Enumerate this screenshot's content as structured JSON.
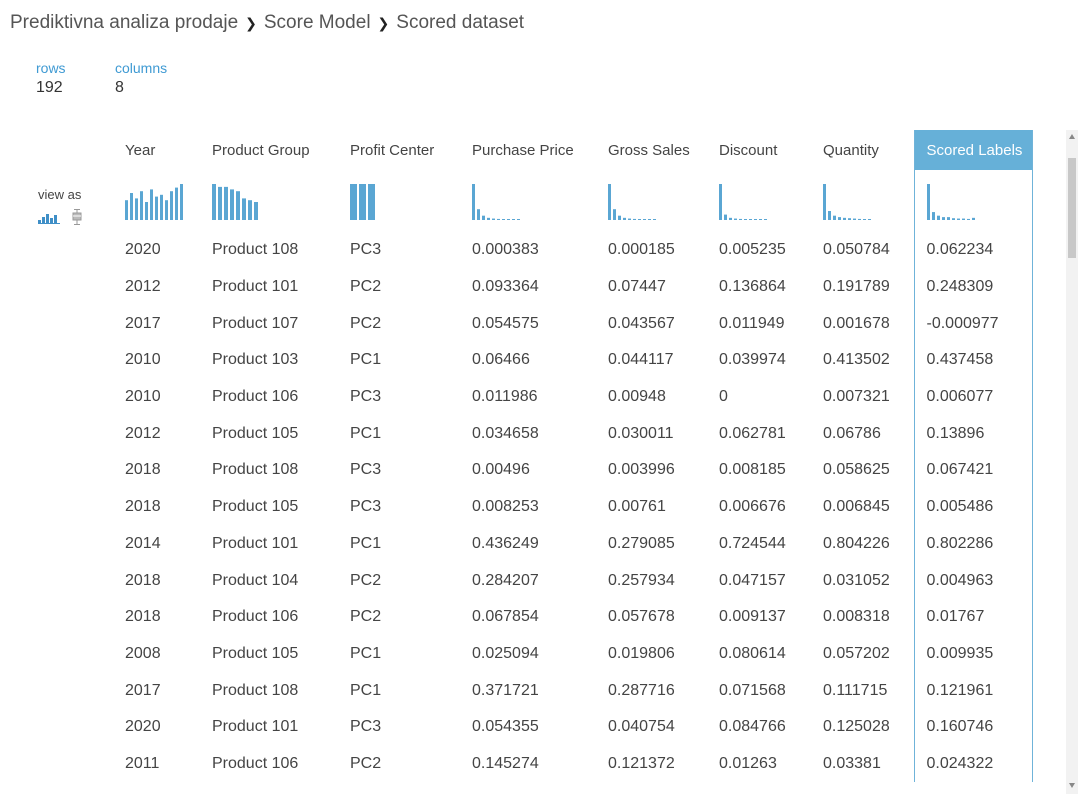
{
  "breadcrumb": [
    "Prediktivna analiza prodaje",
    "Score Model",
    "Scored dataset"
  ],
  "meta": {
    "rows_label": "rows",
    "rows_value": "192",
    "columns_label": "columns",
    "columns_value": "8"
  },
  "view_as": {
    "label": "view as",
    "icons": [
      "histogram-icon",
      "boxplot-icon"
    ]
  },
  "colors": {
    "accent": "#4aa0d0",
    "selected_header": "#66b0d8",
    "bar": "#5aa6d3"
  },
  "columns": [
    "Year",
    "Product Group",
    "Profit Center",
    "Purchase Price",
    "Gross Sales",
    "Discount",
    "Quantity",
    "Scored Labels"
  ],
  "selected_column": 7,
  "histograms": [
    [
      0.55,
      0.75,
      0.6,
      0.8,
      0.5,
      0.85,
      0.65,
      0.7,
      0.55,
      0.8,
      0.9,
      1.0
    ],
    [
      1.0,
      0.92,
      0.92,
      0.85,
      0.8,
      0.6,
      0.55,
      0.5
    ],
    [
      1.0,
      1.0,
      1.0
    ],
    [
      1.0,
      0.3,
      0.12,
      0.06,
      0.04,
      0.03,
      0.02,
      0.02,
      0.01,
      0.01
    ],
    [
      1.0,
      0.3,
      0.12,
      0.06,
      0.04,
      0.03,
      0.02,
      0.02,
      0.01,
      0.01
    ],
    [
      1.0,
      0.15,
      0.06,
      0.04,
      0.03,
      0.02,
      0.02,
      0.02,
      0.01,
      0.01
    ],
    [
      1.0,
      0.25,
      0.12,
      0.08,
      0.06,
      0.05,
      0.04,
      0.03,
      0.02,
      0.02
    ],
    [
      1.0,
      0.22,
      0.12,
      0.08,
      0.08,
      0.05,
      0.04,
      0.04,
      0.03,
      0.06
    ]
  ],
  "rows": [
    [
      "2020",
      "Product 108",
      "PC3",
      "0.000383",
      "0.000185",
      "0.005235",
      "0.050784",
      "0.062234"
    ],
    [
      "2012",
      "Product 101",
      "PC2",
      "0.093364",
      "0.07447",
      "0.136864",
      "0.191789",
      "0.248309"
    ],
    [
      "2017",
      "Product 107",
      "PC2",
      "0.054575",
      "0.043567",
      "0.011949",
      "0.001678",
      "-0.000977"
    ],
    [
      "2010",
      "Product 103",
      "PC1",
      "0.06466",
      "0.044117",
      "0.039974",
      "0.413502",
      "0.437458"
    ],
    [
      "2010",
      "Product 106",
      "PC3",
      "0.011986",
      "0.00948",
      "0",
      "0.007321",
      "0.006077"
    ],
    [
      "2012",
      "Product 105",
      "PC1",
      "0.034658",
      "0.030011",
      "0.062781",
      "0.06786",
      "0.13896"
    ],
    [
      "2018",
      "Product 108",
      "PC3",
      "0.00496",
      "0.003996",
      "0.008185",
      "0.058625",
      "0.067421"
    ],
    [
      "2018",
      "Product 105",
      "PC3",
      "0.008253",
      "0.00761",
      "0.006676",
      "0.006845",
      "0.005486"
    ],
    [
      "2014",
      "Product 101",
      "PC1",
      "0.436249",
      "0.279085",
      "0.724544",
      "0.804226",
      "0.802286"
    ],
    [
      "2018",
      "Product 104",
      "PC2",
      "0.284207",
      "0.257934",
      "0.047157",
      "0.031052",
      "0.004963"
    ],
    [
      "2018",
      "Product 106",
      "PC2",
      "0.067854",
      "0.057678",
      "0.009137",
      "0.008318",
      "0.01767"
    ],
    [
      "2008",
      "Product 105",
      "PC1",
      "0.025094",
      "0.019806",
      "0.080614",
      "0.057202",
      "0.009935"
    ],
    [
      "2017",
      "Product 108",
      "PC1",
      "0.371721",
      "0.287716",
      "0.071568",
      "0.111715",
      "0.121961"
    ],
    [
      "2020",
      "Product 101",
      "PC3",
      "0.054355",
      "0.040754",
      "0.084766",
      "0.125028",
      "0.160746"
    ],
    [
      "2011",
      "Product 106",
      "PC2",
      "0.145274",
      "0.121372",
      "0.01263",
      "0.03381",
      "0.024322"
    ]
  ]
}
